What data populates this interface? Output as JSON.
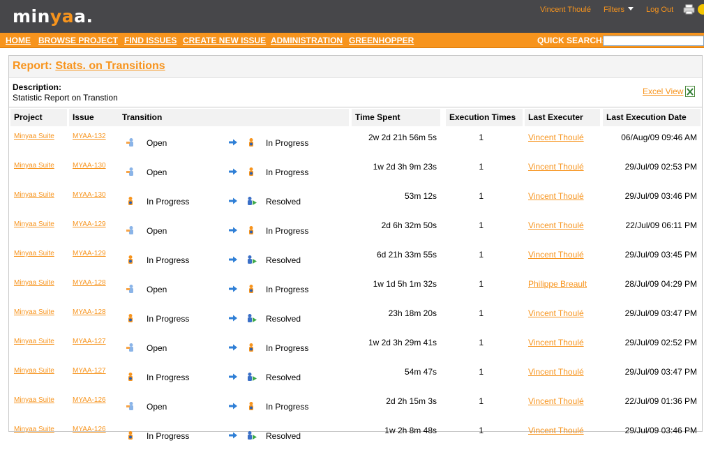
{
  "header": {
    "logo": "minyaa.",
    "user_name": "Vincent Thoulé",
    "filters_label": "Filters",
    "logout_label": "Log Out"
  },
  "nav": {
    "items": [
      "HOME",
      "BROWSE PROJECT",
      "FIND ISSUES",
      "CREATE NEW ISSUE",
      "ADMINISTRATION",
      "GREENHOPPER"
    ],
    "quick_search_label": "QUICK SEARCH:",
    "quick_search_value": ""
  },
  "report": {
    "title_prefix": "Report:",
    "title_link": "Stats. on Transitions",
    "description_label": "Description:",
    "description_text": "Statistic Report on Transtion",
    "excel_label": "Excel View"
  },
  "table": {
    "headers": [
      "Project",
      "Issue",
      "Transition",
      "Time Spent",
      "Execution Times",
      "Last Executer",
      "Last Execution Date"
    ],
    "rows": [
      {
        "project": "Minyaa Suite",
        "issue": "MYAA-132",
        "from": "Open",
        "to": "In Progress",
        "time": "2w 2d 21h 56m 5s",
        "count": "1",
        "executer": "Vincent Thoulé",
        "date": "06/Aug/09 09:46 AM"
      },
      {
        "project": "Minyaa Suite",
        "issue": "MYAA-130",
        "from": "Open",
        "to": "In Progress",
        "time": "1w 2d 3h 9m 23s",
        "count": "1",
        "executer": "Vincent Thoulé",
        "date": "29/Jul/09 02:53 PM"
      },
      {
        "project": "Minyaa Suite",
        "issue": "MYAA-130",
        "from": "In Progress",
        "to": "Resolved",
        "time": "53m 12s",
        "count": "1",
        "executer": "Vincent Thoulé",
        "date": "29/Jul/09 03:46 PM"
      },
      {
        "project": "Minyaa Suite",
        "issue": "MYAA-129",
        "from": "Open",
        "to": "In Progress",
        "time": "2d 6h 32m 50s",
        "count": "1",
        "executer": "Vincent Thoulé",
        "date": "22/Jul/09 06:11 PM"
      },
      {
        "project": "Minyaa Suite",
        "issue": "MYAA-129",
        "from": "In Progress",
        "to": "Resolved",
        "time": "6d 21h 33m 55s",
        "count": "1",
        "executer": "Vincent Thoulé",
        "date": "29/Jul/09 03:45 PM"
      },
      {
        "project": "Minyaa Suite",
        "issue": "MYAA-128",
        "from": "Open",
        "to": "In Progress",
        "time": "1w 1d 5h 1m 32s",
        "count": "1",
        "executer": "Philippe Breault",
        "date": "28/Jul/09 04:29 PM"
      },
      {
        "project": "Minyaa Suite",
        "issue": "MYAA-128",
        "from": "In Progress",
        "to": "Resolved",
        "time": "23h 18m 20s",
        "count": "1",
        "executer": "Vincent Thoulé",
        "date": "29/Jul/09 03:47 PM"
      },
      {
        "project": "Minyaa Suite",
        "issue": "MYAA-127",
        "from": "Open",
        "to": "In Progress",
        "time": "1w 2d 3h 29m 41s",
        "count": "1",
        "executer": "Vincent Thoulé",
        "date": "29/Jul/09 02:52 PM"
      },
      {
        "project": "Minyaa Suite",
        "issue": "MYAA-127",
        "from": "In Progress",
        "to": "Resolved",
        "time": "54m 47s",
        "count": "1",
        "executer": "Vincent Thoulé",
        "date": "29/Jul/09 03:47 PM"
      },
      {
        "project": "Minyaa Suite",
        "issue": "MYAA-126",
        "from": "Open",
        "to": "In Progress",
        "time": "2d 2h 15m 3s",
        "count": "1",
        "executer": "Vincent Thoulé",
        "date": "22/Jul/09 01:36 PM"
      },
      {
        "project": "Minyaa Suite",
        "issue": "MYAA-126",
        "from": "In Progress",
        "to": "Resolved",
        "time": "1w 2h 8m 48s",
        "count": "1",
        "executer": "Vincent Thoulé",
        "date": "29/Jul/09 03:46 PM"
      }
    ]
  },
  "colors": {
    "accent": "#f7941d",
    "topbar": "#47474a",
    "arrow": "#2f7fd6"
  },
  "icons": {
    "open_status": "open-status-icon",
    "in_progress_status": "in-progress-status-icon",
    "resolved_status": "resolved-status-icon",
    "transition_arrow": "arrow-right-icon"
  }
}
